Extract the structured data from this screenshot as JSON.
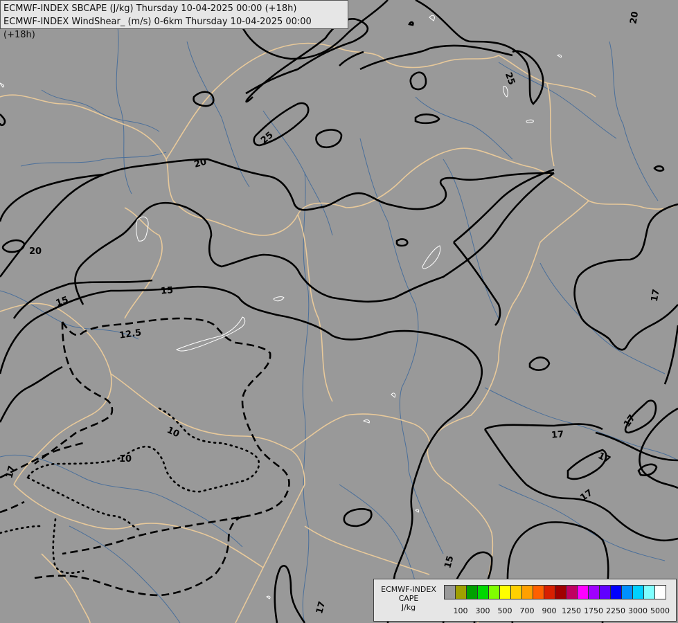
{
  "title_lines": [
    "ECMWF-INDEX SBCAPE (J/kg) Thursday 10-04-2025 00:00 (+18h)",
    "ECMWF-INDEX WindShear_ (m/s) 0-6km Thursday 10-04-2025 00:00 (+18h)"
  ],
  "legend": {
    "title_lines": [
      "ECMWF-INDEX",
      "CAPE",
      "J/kg"
    ],
    "colors": [
      "#999999",
      "#a0a000",
      "#00a000",
      "#00d800",
      "#80ff00",
      "#ffff00",
      "#ffd000",
      "#ffa000",
      "#ff6000",
      "#d82000",
      "#a00000",
      "#c00060",
      "#ff00ff",
      "#a000ff",
      "#6000ff",
      "#0000ff",
      "#0090ff",
      "#00d0ff",
      "#80ffff",
      "#ffffff"
    ],
    "tick_labels": [
      "100",
      "300",
      "500",
      "700",
      "900",
      "1250",
      "1750",
      "2250",
      "3000",
      "5000"
    ]
  },
  "contour_labels": [
    "20",
    "25",
    "25",
    "20",
    "20",
    "15",
    "15",
    "12.5",
    "10",
    "10",
    "17",
    "17",
    "17",
    "17",
    "17",
    "17",
    "15",
    "17"
  ],
  "map": {
    "background": "#999999",
    "border_color": "#e8c99a",
    "river_color": "#4a6f9a",
    "contour_color": "#000000",
    "cape_outline_color": "#ffffff"
  }
}
